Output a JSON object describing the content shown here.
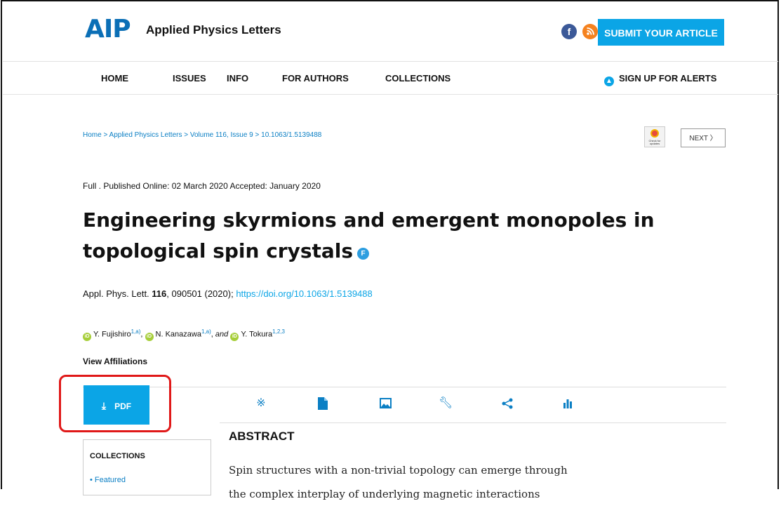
{
  "header": {
    "logo": "AIP",
    "journal": "Applied Physics Letters",
    "social_icons": [
      "facebook-icon",
      "rss-icon"
    ],
    "submit_label": "SUBMIT YOUR ARTICLE",
    "accent_color": "#0ba5e6"
  },
  "nav": {
    "items": [
      "HOME",
      "ISSUES",
      "INFO",
      "FOR AUTHORS",
      "COLLECTIONS"
    ],
    "alerts_label": "SIGN UP FOR ALERTS"
  },
  "breadcrumb": "Home > Applied Physics Letters > Volume 116, Issue 9 > 10.1063/1.5139488",
  "next_label": "NEXT",
  "article": {
    "pub_info": "Full . Published Online: 02 March 2020 Accepted: January 2020",
    "title": "Engineering skyrmions and emergent monopoles in topological spin crystals",
    "badge": "F",
    "citation_prefix": "Appl. Phys. Lett.",
    "volume": "116",
    "citation_suffix": ", 090501 (2020);",
    "doi": "https://doi.org/10.1063/1.5139488",
    "authors": [
      {
        "name": "Y. Fujishiro",
        "sup": "1,a)"
      },
      {
        "name": "N. Kanazawa",
        "sup": "1,a)"
      },
      {
        "name": "Y. Tokura",
        "sup": "1,2,3"
      }
    ],
    "and_text": "and",
    "view_affiliations": "View Affiliations"
  },
  "toolbar": {
    "pdf_label": "PDF",
    "icons": [
      "topics-icon",
      "document-icon",
      "image-icon",
      "tools-icon",
      "share-icon",
      "metrics-icon"
    ]
  },
  "abstract": {
    "heading": "ABSTRACT",
    "line1": "Spin structures with a non-trivial topology can emerge through",
    "line2": "the complex interplay of underlying magnetic interactions"
  },
  "collections": {
    "title": "COLLECTIONS",
    "items": [
      "Featured"
    ]
  }
}
